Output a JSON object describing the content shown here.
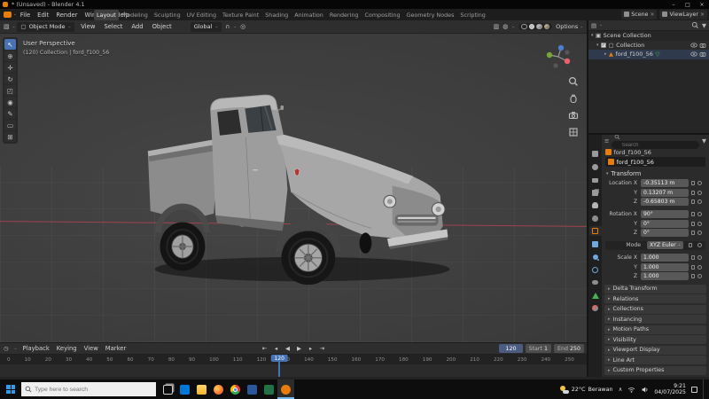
{
  "colors": {
    "accent": "#4772b3",
    "orange": "#e87d0d",
    "axis_x": "#a04350"
  },
  "icons": {
    "caret": "⌄",
    "tri_down": "▾",
    "tri_right": "▸",
    "close": "×",
    "check": "✓",
    "mesh": "▲",
    "mesh_data": "▽",
    "box": "▣",
    "square": "▢",
    "filter": "▼",
    "magnet": "∩",
    "proportional": "◎",
    "overlays": "◍",
    "xray": "▥",
    "editor_3d": "▧",
    "editor_outliner": "▤",
    "editor_props": "≡",
    "editor_timeline": "◷",
    "chevron_up": "∧"
  },
  "titlebar": {
    "title": "* (Unsaved) - Blender 4.1",
    "minimize": "–",
    "maximize": "□",
    "close": "×"
  },
  "topbar": {
    "menus": [
      "File",
      "Edit",
      "Render",
      "Window",
      "Help"
    ],
    "workspaces": [
      {
        "label": "Layout",
        "active": true
      },
      {
        "label": "Modeling"
      },
      {
        "label": "Sculpting"
      },
      {
        "label": "UV Editing"
      },
      {
        "label": "Texture Paint"
      },
      {
        "label": "Shading"
      },
      {
        "label": "Animation"
      },
      {
        "label": "Rendering"
      },
      {
        "label": "Compositing"
      },
      {
        "label": "Geometry Nodes"
      },
      {
        "label": "Scripting"
      }
    ],
    "scene_label": "Scene",
    "view_layer_label": "ViewLayer"
  },
  "tool_header": {
    "mode": "Object Mode",
    "menus": [
      "View",
      "Select",
      "Add",
      "Object"
    ],
    "orientation": "Global",
    "options_label": "Options"
  },
  "viewport": {
    "view_label": "User Perspective",
    "context_label": "(120) Collection | ford_f100_56",
    "gizmo": {
      "x": "#ee5f6e",
      "y": "#76a832",
      "z": "#4a7fd0"
    },
    "tools": [
      {
        "name": "tweak-tool",
        "glyph": "↖",
        "active": true
      },
      {
        "name": "cursor-tool",
        "glyph": "⊕"
      },
      {
        "name": "move-tool",
        "glyph": "✛"
      },
      {
        "name": "rotate-tool",
        "glyph": "↻"
      },
      {
        "name": "scale-tool",
        "glyph": "◰"
      },
      {
        "name": "transform-tool",
        "glyph": "◉"
      },
      {
        "name": "annotate-tool",
        "glyph": "✎"
      },
      {
        "name": "measure-tool",
        "glyph": "▭"
      },
      {
        "name": "add-cube-tool",
        "glyph": "⊞"
      }
    ]
  },
  "outliner": {
    "scene_collection": "Scene Collection",
    "collection": "Collection",
    "object": "ford_f100_56"
  },
  "properties": {
    "search_placeholder": "Search",
    "breadcrumb_object": "ford_f100_56",
    "name_value": "ford_f100_56",
    "transform_title": "Transform",
    "tabs": [
      {
        "name": "tool-tab",
        "cls": "pt-tool"
      },
      {
        "name": "render-tab",
        "cls": "pt-render"
      },
      {
        "name": "output-tab",
        "cls": "pt-output"
      },
      {
        "name": "view-layer-tab",
        "cls": "pt-viewlayer"
      },
      {
        "name": "scene-tab",
        "cls": "pt-scene"
      },
      {
        "name": "world-tab",
        "cls": "pt-world"
      },
      {
        "name": "object-tab",
        "cls": "pt-object",
        "active": true
      },
      {
        "name": "modifiers-tab",
        "cls": "pt-modifiers"
      },
      {
        "name": "particles-tab",
        "cls": "pt-particles"
      },
      {
        "name": "physics-tab",
        "cls": "pt-physics"
      },
      {
        "name": "constraints-tab",
        "cls": "pt-constraints"
      },
      {
        "name": "object-data-tab",
        "cls": "pt-data"
      },
      {
        "name": "material-tab",
        "cls": "pt-material"
      }
    ],
    "transform_rows": [
      {
        "label": "Location X",
        "value": "-0.35113 m"
      },
      {
        "label": "Y",
        "value": "0.13207 m"
      },
      {
        "label": "Z",
        "value": "-0.65803 m"
      },
      {
        "label": "Rotation X",
        "value": "90°",
        "cls": "gap"
      },
      {
        "label": "Y",
        "value": "0°"
      },
      {
        "label": "Z",
        "value": "0°"
      },
      {
        "label": "Mode",
        "value": "XYZ Euler",
        "cls": "gap dropdown"
      },
      {
        "label": "Scale X",
        "value": "1.000",
        "cls": "gap"
      },
      {
        "label": "Y",
        "value": "1.000"
      },
      {
        "label": "Z",
        "value": "1.000"
      }
    ],
    "panels": [
      "Delta Transform",
      "Relations",
      "Collections",
      "Instancing",
      "Motion Paths",
      "Visibility",
      "Viewport Display",
      "Line Art",
      "Custom Properties"
    ]
  },
  "timeline": {
    "menus": [
      "Playback",
      "Keying",
      "View",
      "Marker"
    ],
    "transport": [
      {
        "name": "jump-to-start-button",
        "glyph": "⇤"
      },
      {
        "name": "prev-keyframe-button",
        "glyph": "◂"
      },
      {
        "name": "play-reverse-button",
        "glyph": "◀"
      },
      {
        "name": "play-button",
        "glyph": "▶"
      },
      {
        "name": "next-keyframe-button",
        "glyph": "▸"
      },
      {
        "name": "jump-to-end-button",
        "glyph": "⇥"
      }
    ],
    "current_frame": "120",
    "start_label": "Start",
    "start_value": "1",
    "end_label": "End",
    "end_value": "250",
    "frames": [
      "0",
      "10",
      "20",
      "30",
      "40",
      "50",
      "60",
      "70",
      "80",
      "90",
      "100",
      "110",
      "120",
      "130",
      "140",
      "150",
      "160",
      "170",
      "180",
      "190",
      "200",
      "210",
      "220",
      "230",
      "240",
      "250"
    ]
  },
  "taskbar": {
    "search_placeholder": "Type here to search",
    "icons": [
      {
        "name": "task-view-icon",
        "cls": "tb-taskview"
      },
      {
        "name": "mail-icon",
        "cls": "tb-mail"
      },
      {
        "name": "file-explorer-icon",
        "cls": "tb-explorer"
      },
      {
        "name": "firefox-icon",
        "cls": "tb-firefox"
      },
      {
        "name": "chrome-icon",
        "cls": "tb-chrome"
      },
      {
        "name": "word-icon",
        "cls": "tb-word"
      },
      {
        "name": "excel-icon",
        "cls": "tb-excel"
      },
      {
        "name": "blender-icon",
        "cls": "tb-blender",
        "active": true
      }
    ],
    "weather_temp": "22°C",
    "weather_desc": "Berawan",
    "time": "9:21",
    "date": "04/07/2025"
  }
}
